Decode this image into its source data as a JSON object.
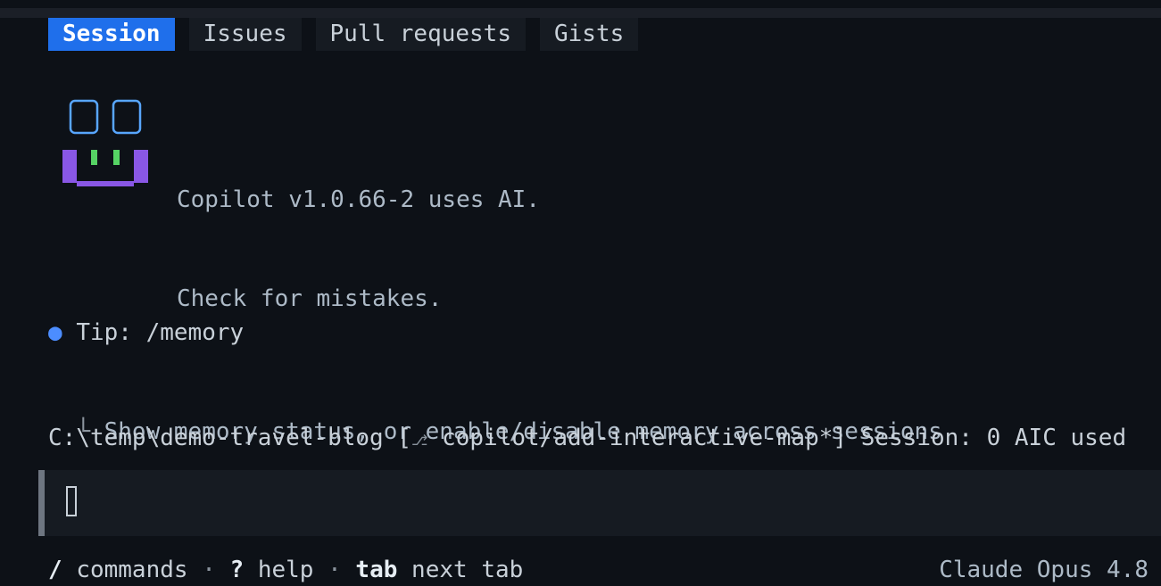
{
  "tabs": [
    {
      "label": "Session",
      "active": true
    },
    {
      "label": "Issues",
      "active": false
    },
    {
      "label": "Pull requests",
      "active": false
    },
    {
      "label": "Gists",
      "active": false
    }
  ],
  "intro": {
    "line1": "Copilot v1.0.66-2 uses AI.",
    "line2": "Check for mistakes."
  },
  "tip": {
    "bullet": "●",
    "title": "Tip: /memory",
    "corner": "└",
    "description": "Show memory status, or enable/disable memory across sessions"
  },
  "status_bar": {
    "path": "C:\\temp\\demo-travel-blog",
    "branch_icon": "branch-icon",
    "branch": "copilot/add-interactive-map*",
    "session": "Session: 0 AIC used"
  },
  "input": {
    "value": ""
  },
  "footer": {
    "commands_key": "/",
    "commands_label": "commands",
    "help_key": "?",
    "help_label": "help",
    "tab_key": "tab",
    "tab_label": "next tab",
    "separator": "·",
    "model": "Claude Opus 4.8"
  },
  "colors": {
    "background": "#0d1117",
    "active_tab": "#1f6feb",
    "logo_eyes": "#58a6ff",
    "logo_mouth": "#8957e5",
    "logo_teeth": "#56d364",
    "tip_bullet": "#4c8dff"
  }
}
